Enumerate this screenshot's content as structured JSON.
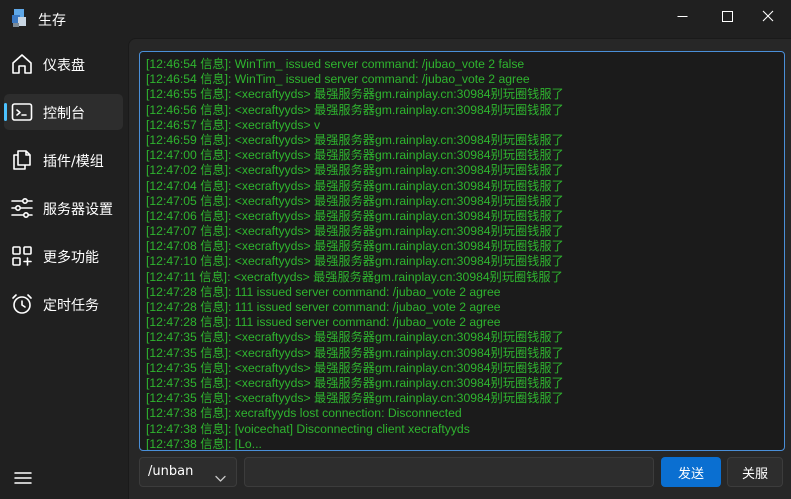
{
  "window": {
    "title": "生存",
    "controls": [
      "minimize-icon",
      "maximize-icon",
      "close-icon"
    ]
  },
  "sidebar": {
    "items": [
      {
        "label": "仪表盘",
        "icon": "home-icon",
        "active": false
      },
      {
        "label": "控制台",
        "icon": "terminal-icon",
        "active": true
      },
      {
        "label": "插件/模组",
        "icon": "copy-icon",
        "active": false
      },
      {
        "label": "服务器设置",
        "icon": "sliders-icon",
        "active": false
      },
      {
        "label": "更多功能",
        "icon": "apps-add-icon",
        "active": false
      },
      {
        "label": "定时任务",
        "icon": "alarm-icon",
        "active": false
      }
    ],
    "menu_icon": "hamburger-icon"
  },
  "console": {
    "text_color": "#2fb52f",
    "lines": [
      "[12:46:54 信息]: WinTim_ issued server command: /jubao_vote 2 false",
      "[12:46:54 信息]: WinTim_ issued server command: /jubao_vote 2 agree",
      "[12:46:55 信息]: <xecraftyyds> 最强服务器gm.rainplay.cn:30984别玩圈钱服了",
      "[12:46:56 信息]: <xecraftyyds> 最强服务器gm.rainplay.cn:30984别玩圈钱服了",
      "[12:46:57 信息]: <xecraftyyds> v",
      "[12:46:59 信息]: <xecraftyyds> 最强服务器gm.rainplay.cn:30984别玩圈钱服了",
      "[12:47:00 信息]: <xecraftyyds> 最强服务器gm.rainplay.cn:30984别玩圈钱服了",
      "[12:47:02 信息]: <xecraftyyds> 最强服务器gm.rainplay.cn:30984别玩圈钱服了",
      "[12:47:04 信息]: <xecraftyyds> 最强服务器gm.rainplay.cn:30984别玩圈钱服了",
      "[12:47:05 信息]: <xecraftyyds> 最强服务器gm.rainplay.cn:30984别玩圈钱服了",
      "[12:47:06 信息]: <xecraftyyds> 最强服务器gm.rainplay.cn:30984别玩圈钱服了",
      "[12:47:07 信息]: <xecraftyyds> 最强服务器gm.rainplay.cn:30984别玩圈钱服了",
      "[12:47:08 信息]: <xecraftyyds> 最强服务器gm.rainplay.cn:30984别玩圈钱服了",
      "[12:47:10 信息]: <xecraftyyds> 最强服务器gm.rainplay.cn:30984别玩圈钱服了",
      "[12:47:11 信息]: <xecraftyyds> 最强服务器gm.rainplay.cn:30984别玩圈钱服了",
      "[12:47:28 信息]: 111 issued server command: /jubao_vote 2 agree",
      "[12:47:28 信息]: 111 issued server command: /jubao_vote 2 agree",
      "[12:47:28 信息]: 111 issued server command: /jubao_vote 2 agree",
      "[12:47:35 信息]: <xecraftyyds> 最强服务器gm.rainplay.cn:30984别玩圈钱服了",
      "[12:47:35 信息]: <xecraftyyds> 最强服务器gm.rainplay.cn:30984别玩圈钱服了",
      "[12:47:35 信息]: <xecraftyyds> 最强服务器gm.rainplay.cn:30984别玩圈钱服了",
      "[12:47:35 信息]: <xecraftyyds> 最强服务器gm.rainplay.cn:30984别玩圈钱服了",
      "[12:47:35 信息]: <xecraftyyds> 最强服务器gm.rainplay.cn:30984别玩圈钱服了",
      "[12:47:38 信息]: xecraftyyds lost connection: Disconnected",
      "[12:47:38 信息]: [voicechat] Disconnecting client xecraftyyds",
      "[12:47:38 信息]: [Lo..."
    ]
  },
  "command_bar": {
    "selected_command": "/unban",
    "input_value": "",
    "input_placeholder": "",
    "send_label": "发送",
    "close_label": "关服"
  },
  "colors": {
    "accent": "#0a6fd1",
    "nav_indicator": "#4cc2ff",
    "console_border": "#4a8fd8"
  }
}
